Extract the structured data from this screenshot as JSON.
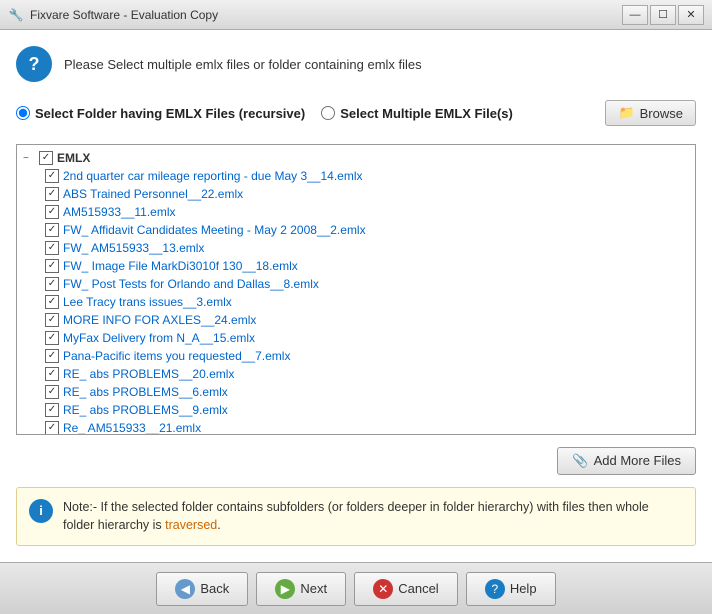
{
  "window": {
    "title": "Fixvare Software - Evaluation Copy",
    "icon": "🔧"
  },
  "header": {
    "text": "Please Select multiple emlx files or folder containing emlx files"
  },
  "options": {
    "radio1_label": "Select Folder having EMLX Files (recursive)",
    "radio2_label": "Select Multiple EMLX File(s)",
    "radio1_selected": true,
    "browse_label": "Browse"
  },
  "file_tree": {
    "root_label": "EMLX",
    "files": [
      "2nd quarter car mileage reporting - due May 3__14.emlx",
      "ABS Trained Personnel__22.emlx",
      "AM515933__11.emlx",
      "FW_ Affidavit Candidates Meeting - May 2 2008__2.emlx",
      "FW_ AM515933__13.emlx",
      "FW_ Image File MarkDi3010f 130__18.emlx",
      "FW_ Post Tests for Orlando and Dallas__8.emlx",
      "Lee Tracy trans issues__3.emlx",
      "MORE INFO FOR AXLES__24.emlx",
      "MyFax Delivery from N_A__15.emlx",
      "Pana-Pacific items you requested__7.emlx",
      "RE_ abs PROBLEMS__20.emlx",
      "RE_ abs PROBLEMS__6.emlx",
      "RE_ abs PROBLEMS__9.emlx",
      "Re_ AM515933__21.emlx"
    ]
  },
  "add_files_button": {
    "label": "Add More Files",
    "icon": "📎"
  },
  "note": {
    "text_part1": "Note:- If the selected folder contains subfolders (or folders deeper in folder hierarchy) with files then whole folder hierarchy is",
    "highlight": "traversed",
    "text_part2": "."
  },
  "buttons": {
    "back": "Back",
    "next": "Next",
    "cancel": "Cancel",
    "help": "Help"
  }
}
